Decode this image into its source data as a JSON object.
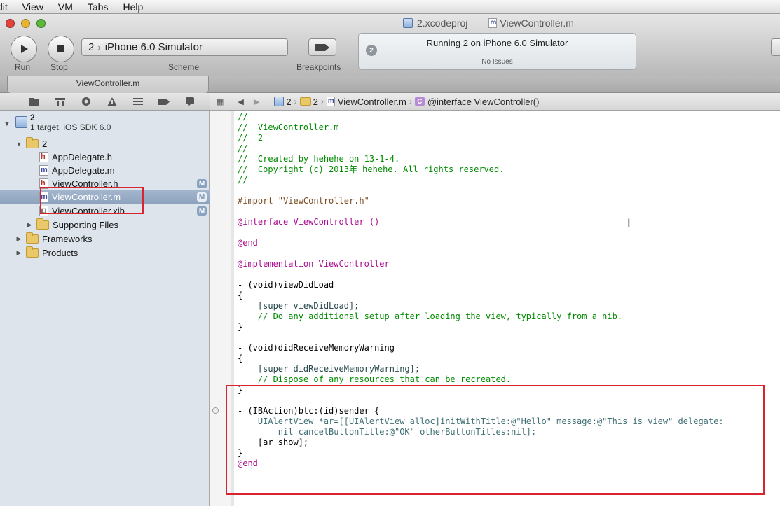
{
  "menubar": {
    "items": [
      "dit",
      "View",
      "VM",
      "Tabs",
      "Help"
    ]
  },
  "window": {
    "title_project": "2.xcodeproj",
    "title_sep": "—",
    "title_file": "ViewController.m"
  },
  "toolbar": {
    "run_label": "Run",
    "stop_label": "Stop",
    "scheme_label": "Scheme",
    "scheme_target": "2",
    "scheme_device": "iPhone 6.0 Simulator",
    "breakpoints_label": "Breakpoints",
    "activity_status": "Running 2 on iPhone 6.0 Simulator",
    "activity_issues": "No Issues",
    "activity_count": "2"
  },
  "tabs": [
    {
      "label": "ViewController.m"
    }
  ],
  "navigator": {
    "project": {
      "name": "2",
      "subtitle": "1 target, iOS SDK 6.0"
    },
    "items": [
      {
        "label": "2",
        "kind": "folder",
        "indent": 1,
        "expanded": true
      },
      {
        "label": "AppDelegate.h",
        "kind": "h",
        "indent": 2,
        "badge": ""
      },
      {
        "label": "AppDelegate.m",
        "kind": "m",
        "indent": 2,
        "badge": ""
      },
      {
        "label": "ViewController.h",
        "kind": "h",
        "indent": 2,
        "badge": "M"
      },
      {
        "label": "ViewController.m",
        "kind": "m",
        "indent": 2,
        "badge": "M",
        "selected": true
      },
      {
        "label": "ViewController.xib",
        "kind": "xib",
        "indent": 2,
        "badge": "M"
      },
      {
        "label": "Supporting Files",
        "kind": "folder",
        "indent": 2,
        "expanded": false
      },
      {
        "label": "Frameworks",
        "kind": "folder",
        "indent": 1,
        "expanded": false
      },
      {
        "label": "Products",
        "kind": "folder",
        "indent": 1,
        "expanded": false
      }
    ]
  },
  "jumpbar": {
    "items": [
      "2",
      "2",
      "ViewController.m",
      "@interface ViewController()"
    ]
  },
  "code": {
    "lines": [
      "//",
      "//  ViewController.m",
      "//  2",
      "//",
      "//  Created by hehehe on 13-1-4.",
      "//  Copyright (c) 2013年 hehehe. All rights reserved.",
      "//",
      "",
      "#import \"ViewController.h\"",
      "",
      "@interface ViewController ()",
      "",
      "@end",
      "",
      "@implementation ViewController",
      "",
      "- (void)viewDidLoad",
      "{",
      "    [super viewDidLoad];",
      "    // Do any additional setup after loading the view, typically from a nib.",
      "}",
      "",
      "- (void)didReceiveMemoryWarning",
      "{",
      "    [super didReceiveMemoryWarning];",
      "    // Dispose of any resources that can be recreated.",
      "}",
      "",
      "- (IBAction)btc:(id)sender {",
      "    UIAlertView *ar=[[UIAlertView alloc]initWithTitle:@\"Hello\" message:@\"This is view\" delegate:",
      "        nil cancelButtonTitle:@\"OK\" otherButtonTitles:nil];",
      "    [ar show];",
      "}",
      "@end"
    ]
  },
  "colors": {
    "annotation": "#d9232e",
    "comment": "#008a00",
    "keyword": "#aa0d91",
    "string": "#c41a16",
    "class": "#3f6e74"
  }
}
